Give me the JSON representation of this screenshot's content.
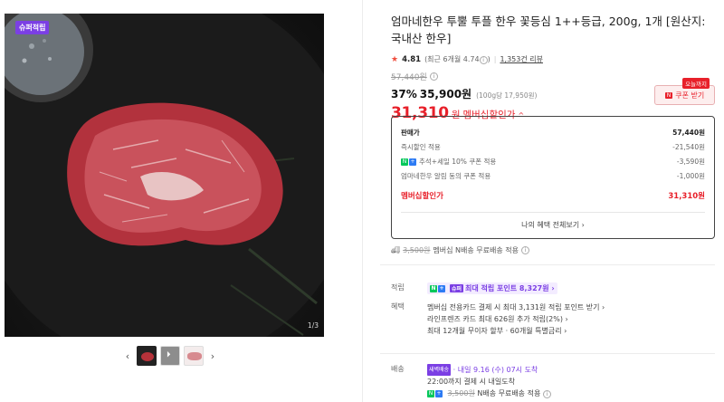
{
  "gallery": {
    "badge": "슈퍼적립",
    "counter": "1/3",
    "prev_icon": "‹",
    "next_icon": "›"
  },
  "product": {
    "title": "엄마네한우 투뿔 투플 한우 꽃등심 1++등급, 200g, 1개 [원산지: 국내산 한우]",
    "rating": "4.81",
    "rating_recent": "(최근 6개월 4.74",
    "review_count": "1,353건 리뷰",
    "original_price": "57,440원",
    "discount_rate": "37%",
    "sale_price": "35,900원",
    "unit_price": "(100g당 17,950원)",
    "member_price": "31,310",
    "member_price_unit": "원",
    "member_price_label": "멤버십할인가"
  },
  "coupon": {
    "tag": "오늘까지",
    "label": "쿠폰 받기",
    "icon": "N"
  },
  "breakdown": {
    "head_label": "판매가",
    "head_value": "57,440원",
    "rows": [
      {
        "label": "즉시할인 적용",
        "value": "-21,540원"
      },
      {
        "label": "추석+세일 10% 쿠폰 적용",
        "value": "-3,590원"
      },
      {
        "label": "엄마네한우 알림 동의 쿠폰 적용",
        "value": "-1,000원"
      }
    ],
    "total_label": "멤버십할인가",
    "total_value": "31,310원",
    "all_benefits": "나의 혜택 전체보기 ›"
  },
  "shipping_line": {
    "strike": "3,500원",
    "text": "멤버십 N배송 무료배송 적용"
  },
  "points": {
    "label": "적립",
    "badge": "슈퍼",
    "link": "최대 적립 포인트 8,327원 ›"
  },
  "benefits": {
    "label": "혜택",
    "lines": [
      "멤버십 전용카드 결제 시 최대 3,131원 적립 포인트 받기 ›",
      "라인프렌즈 카드 최대 626원 추가 적립(2%) ›",
      "최대 12개월 무이자 할부 · 60개월 특별금리 ›"
    ]
  },
  "delivery": {
    "label": "배송",
    "badge": "새벽배송",
    "arrival": "· 내일 9.16 (수) 07시 도착",
    "cutoff": "22:00까지 결제 시 내일도착",
    "strike": "3,500원",
    "free": "N배송 무료배송 적용"
  },
  "colors": {
    "accent_red": "#e8202a",
    "accent_purple": "#7b3fe4",
    "naver_green": "#03c75a"
  }
}
